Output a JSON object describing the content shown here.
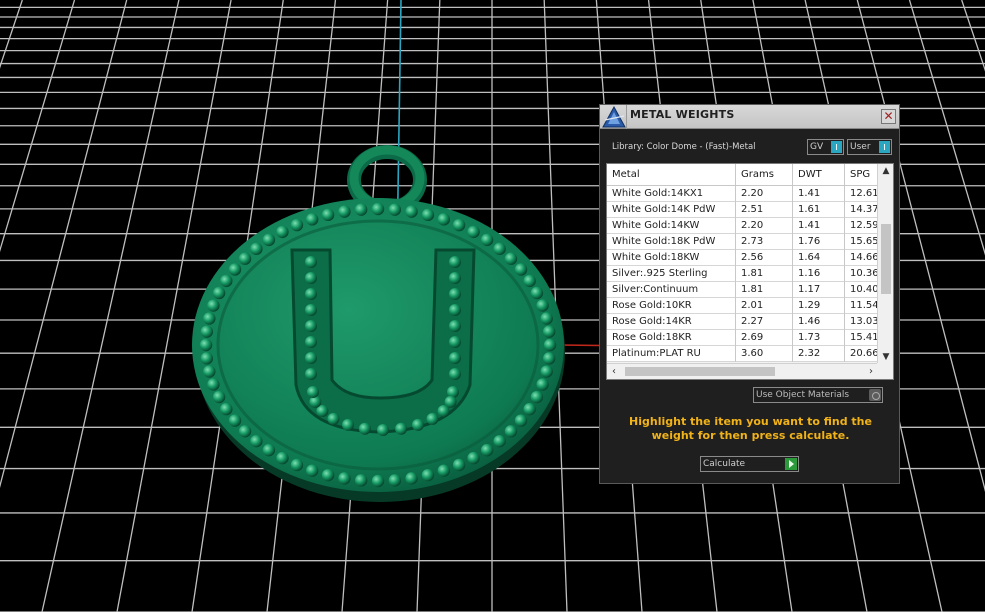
{
  "panel": {
    "title": "METAL WEIGHTS",
    "close_label": "✕",
    "library_label": "Library: Color Dome - (Fast)-Metal",
    "gv_label": "GV",
    "user_label": "User",
    "columns": [
      "Metal",
      "Grams",
      "DWT",
      "SPG"
    ],
    "rows": [
      [
        "White Gold:14KX1",
        "2.20",
        "1.41",
        "12.61"
      ],
      [
        "White Gold:14K PdW",
        "2.51",
        "1.61",
        "14.37"
      ],
      [
        "White Gold:14KW",
        "2.20",
        "1.41",
        "12.59"
      ],
      [
        "White Gold:18K PdW",
        "2.73",
        "1.76",
        "15.65"
      ],
      [
        "White Gold:18KW",
        "2.56",
        "1.64",
        "14.66"
      ],
      [
        "Silver:.925 Sterling",
        "1.81",
        "1.16",
        "10.36"
      ],
      [
        "Silver:Continuum",
        "1.81",
        "1.17",
        "10.40"
      ],
      [
        "Rose Gold:10KR",
        "2.01",
        "1.29",
        "11.54"
      ],
      [
        "Rose Gold:14KR",
        "2.27",
        "1.46",
        "13.03"
      ],
      [
        "Rose Gold:18KR",
        "2.69",
        "1.73",
        "15.41"
      ],
      [
        "Platinum:PLAT RU",
        "3.60",
        "2.32",
        "20.66"
      ]
    ],
    "materials_label": "Use Object Materials",
    "instruction": "Highlight the item you want to find the weight for then press calculate.",
    "calculate_label": "Calculate"
  },
  "viewport": {
    "pendant_letter": "U",
    "pendant_color": "#0e7a52",
    "grid_color": "#bfbfbf",
    "axis_y_color": "#2aa6c0",
    "axis_x_color": "#c0281c"
  }
}
